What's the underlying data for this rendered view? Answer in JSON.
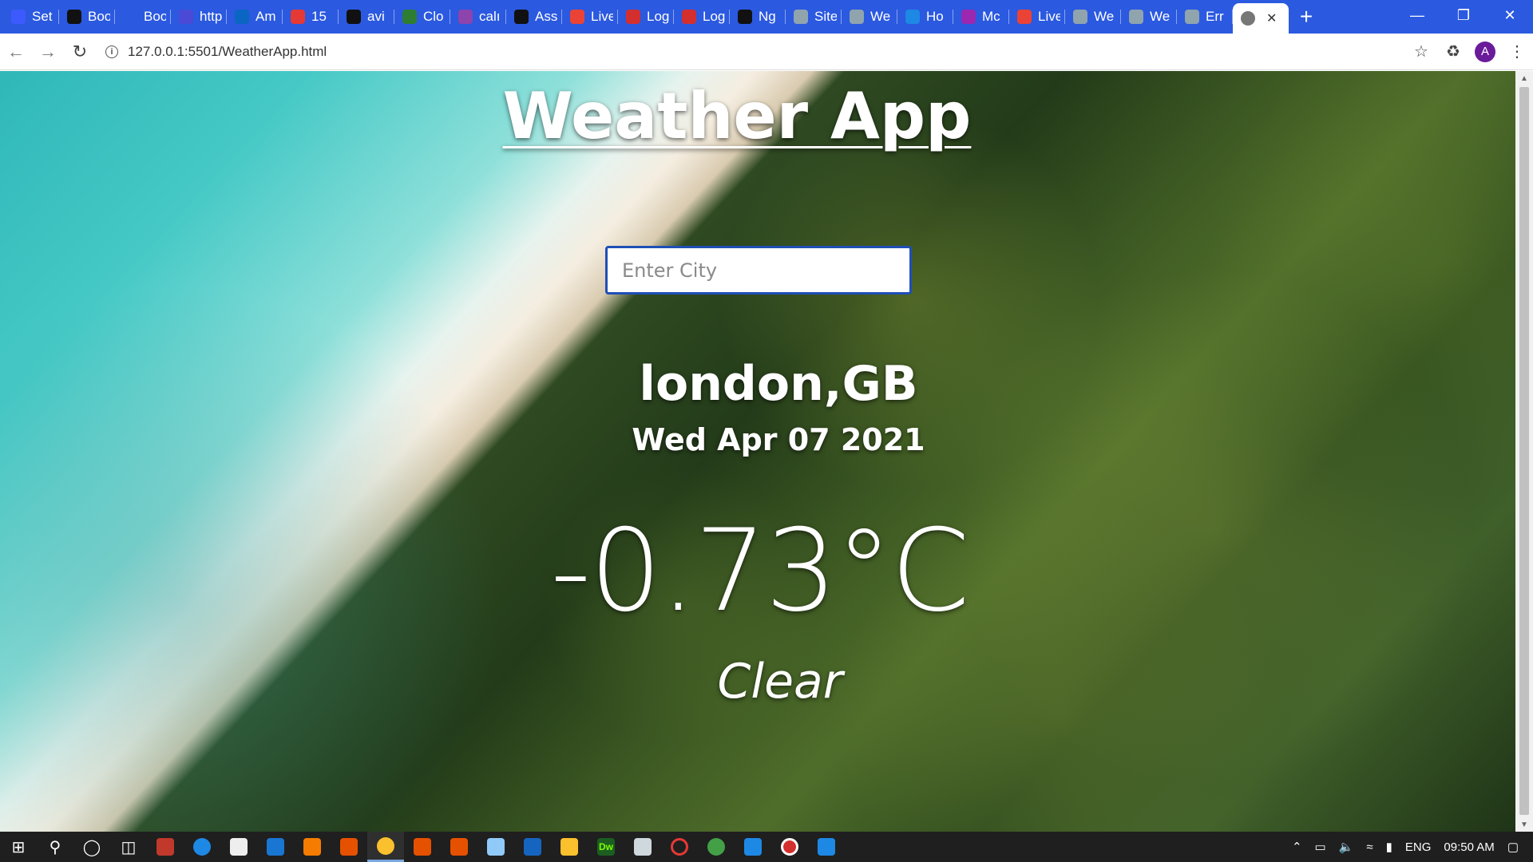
{
  "browser": {
    "tabs": [
      {
        "label": "Set",
        "color": "#3d5afe"
      },
      {
        "label": "Boo",
        "color": "#111111"
      },
      {
        "label": "Boo",
        "color": "#2b59e0"
      },
      {
        "label": "http",
        "color": "#4a4ad6"
      },
      {
        "label": "Am",
        "color": "#0a66c2"
      },
      {
        "label": "15",
        "color": "#e53935"
      },
      {
        "label": "avi",
        "color": "#111111"
      },
      {
        "label": "Clo",
        "color": "#2e7d32"
      },
      {
        "label": "calı",
        "color": "#8e44ad"
      },
      {
        "label": "Ass",
        "color": "#111111"
      },
      {
        "label": "Live",
        "color": "#ea4335"
      },
      {
        "label": "Log",
        "color": "#d32f2f"
      },
      {
        "label": "Log",
        "color": "#d32f2f"
      },
      {
        "label": "Ng",
        "color": "#111111"
      },
      {
        "label": "Site",
        "color": "#90a4ae"
      },
      {
        "label": "We",
        "color": "#90a4ae"
      },
      {
        "label": "Ho",
        "color": "#1e88e5"
      },
      {
        "label": "Mc",
        "color": "#9c27b0"
      },
      {
        "label": "Live",
        "color": "#ea4335"
      },
      {
        "label": "We",
        "color": "#90a4ae"
      },
      {
        "label": "We",
        "color": "#90a4ae"
      },
      {
        "label": "Err",
        "color": "#90a4ae"
      }
    ],
    "active_tab_icon": "globe-icon",
    "url": "127.0.0.1:5501/WeatherApp.html",
    "avatar_initial": "A"
  },
  "app": {
    "title": "Weather App",
    "search_placeholder": "Enter City",
    "location": "london,GB",
    "date": "Wed Apr 07 2021",
    "temperature": "-0.73°C",
    "condition": "Clear"
  },
  "taskbar": {
    "language": "ENG",
    "time": "09:50 AM"
  }
}
